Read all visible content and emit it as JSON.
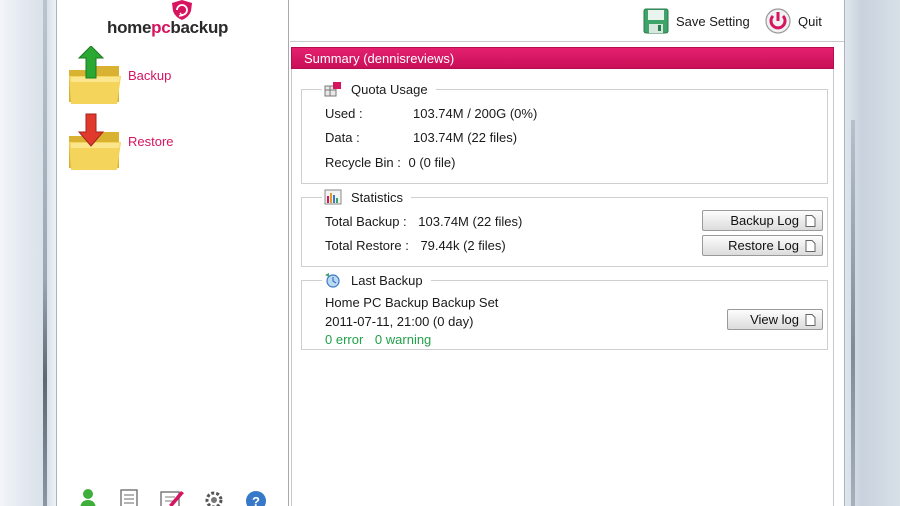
{
  "logo": {
    "part1": "home",
    "part2": "pc",
    "part3": "backup"
  },
  "nav": {
    "items": [
      {
        "label": "Backup",
        "icon": "backup-folder-icon"
      },
      {
        "label": "Restore",
        "icon": "restore-folder-icon"
      }
    ],
    "bottom_icons": [
      "user-icon",
      "document-icon",
      "edit-icon",
      "settings-icon",
      "help-icon"
    ]
  },
  "toolbar": {
    "save_label": "Save Setting",
    "quit_label": "Quit"
  },
  "summary": {
    "title": "Summary (dennisreviews)",
    "quota": {
      "title": "Quota Usage",
      "used_label": "Used :",
      "used_value": "103.74M / 200G (0%)",
      "data_label": "Data :",
      "data_value": "103.74M  (22 files)",
      "recycle_label": "Recycle Bin :",
      "recycle_value": "0  (0 file)"
    },
    "statistics": {
      "title": "Statistics",
      "total_backup_label": "Total Backup :",
      "total_backup_value": "103.74M  (22 files)",
      "total_restore_label": "Total Restore :",
      "total_restore_value": "79.44k  (2 files)",
      "backup_log_button": "Backup Log",
      "restore_log_button": "Restore Log"
    },
    "last_backup": {
      "title": "Last Backup",
      "set_name": "Home PC Backup Backup Set",
      "time": "2011-07-11, 21:00 (0 day)",
      "errors": "0 error",
      "warnings": "0 warning",
      "view_log_button": "View log"
    }
  },
  "colors": {
    "accent": "#d6145f",
    "ok": "#22a04a"
  }
}
